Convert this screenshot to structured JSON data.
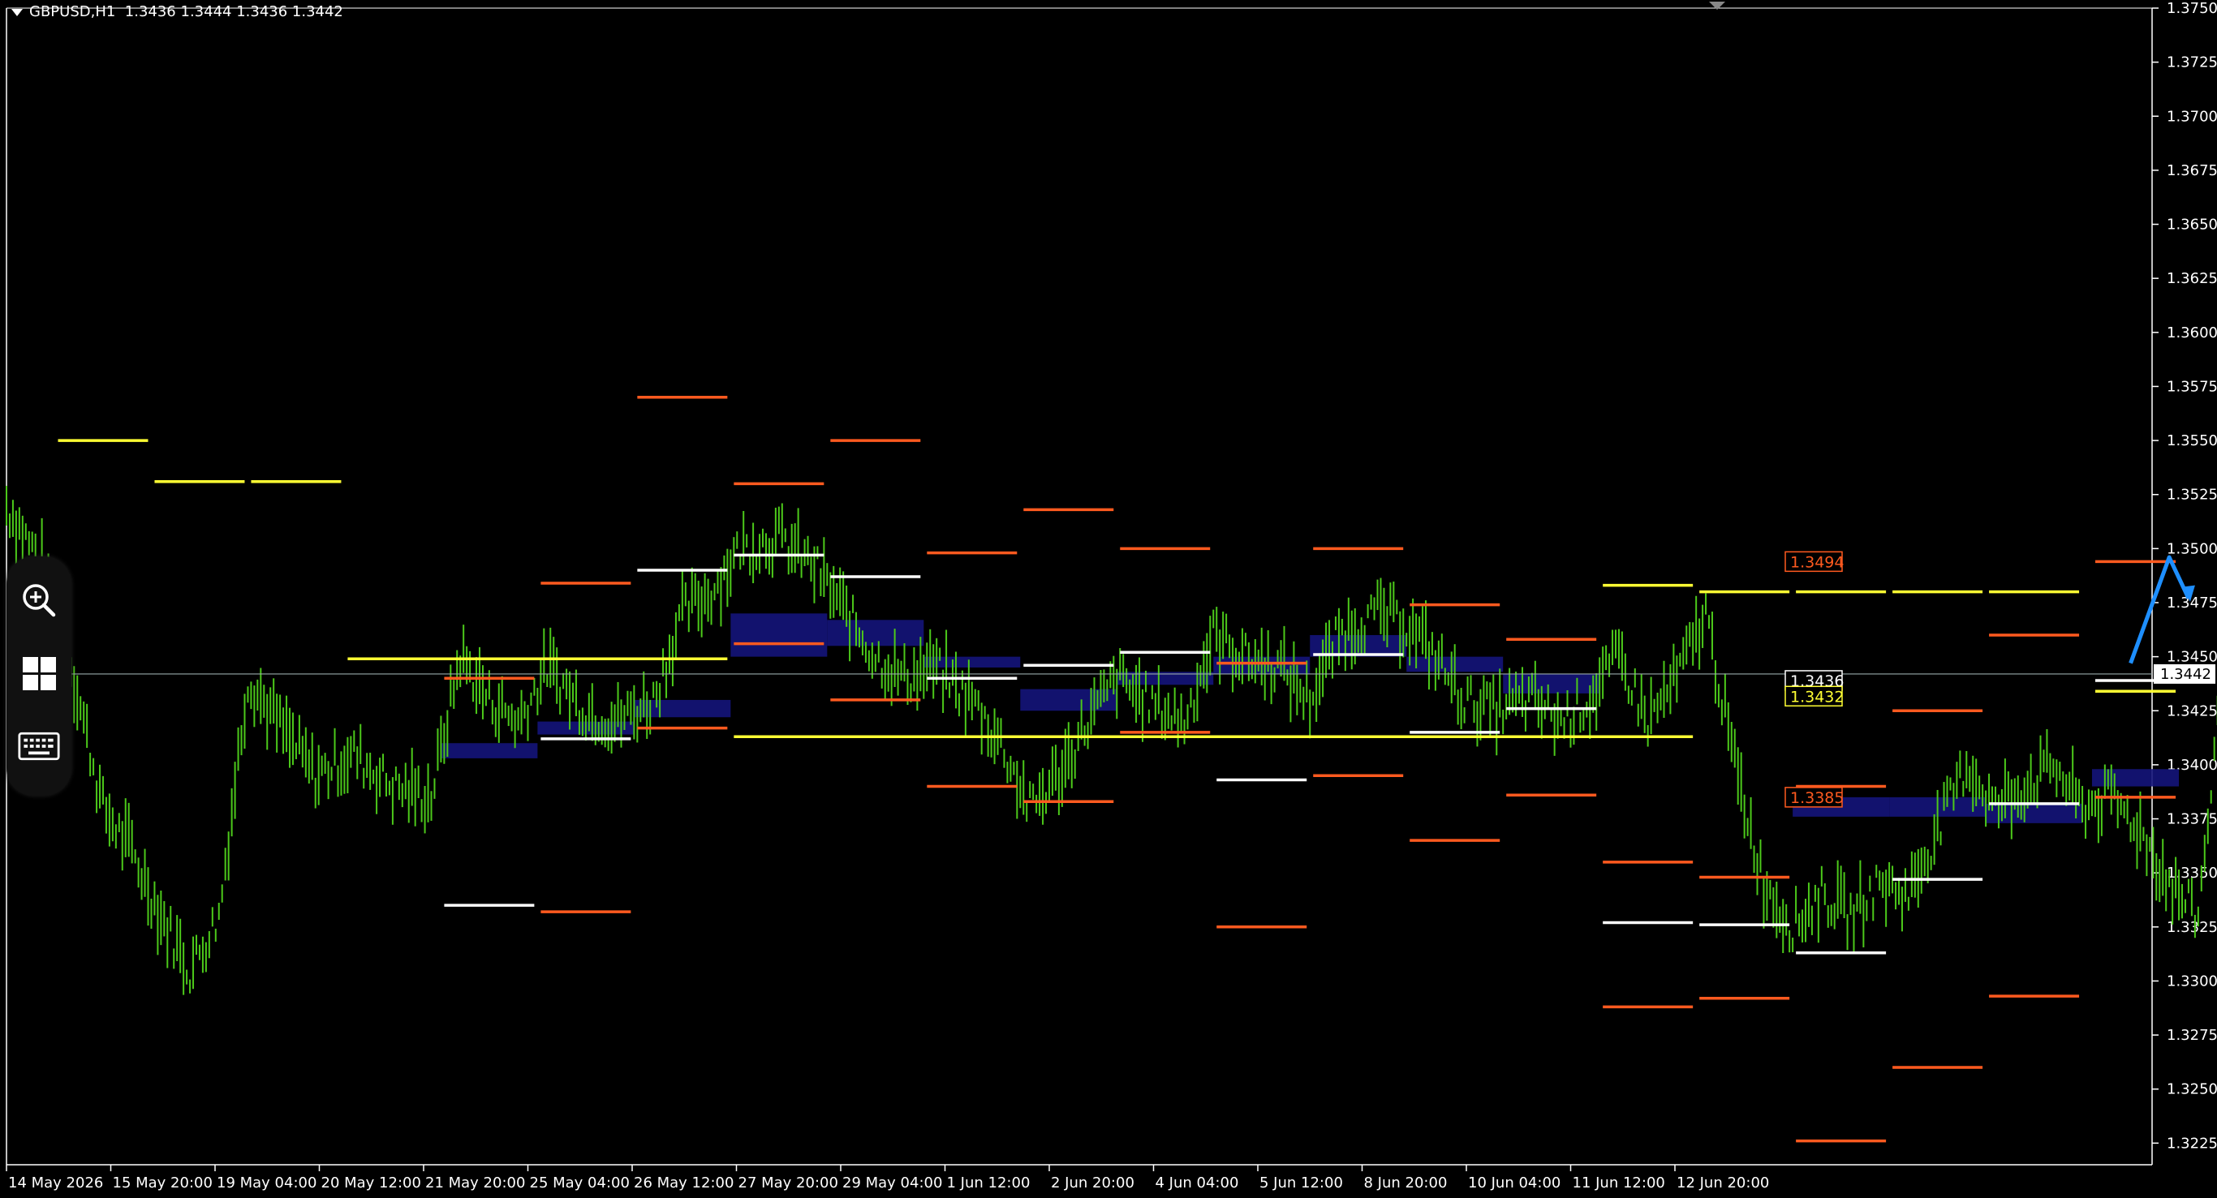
{
  "header": {
    "symbol": "GBPUSD,H1",
    "ohlc": "1.3436 1.3444 1.3436 1.3442"
  },
  "toolbar": {
    "items": [
      {
        "icon": "zoom-in-icon"
      },
      {
        "icon": "window-grid-icon"
      },
      {
        "icon": "keyboard-icon"
      }
    ]
  },
  "colors": {
    "background": "#000000",
    "candles": "#4CC91A",
    "grid_axis": "#ffffff",
    "level_orange": "#ff5a1f",
    "level_yellow": "#ffff33",
    "level_white": "#ffffff",
    "zone_blue": "#14147a",
    "arrow_blue": "#1e8fff"
  },
  "chart_data": {
    "type": "line",
    "symbol": "GBPUSD",
    "timeframe": "H1",
    "ylim": [
      1.3215,
      1.375
    ],
    "y_ticks": [
      "1.3750",
      "1.3725",
      "1.3700",
      "1.3675",
      "1.3650",
      "1.3625",
      "1.3600",
      "1.3575",
      "1.3550",
      "1.3525",
      "1.3500",
      "1.3475",
      "1.3450",
      "1.3425",
      "1.3400",
      "1.3375",
      "1.3350",
      "1.3325",
      "1.3300",
      "1.3275",
      "1.3250",
      "1.3225"
    ],
    "x_ticks": [
      "14 May 2026",
      "15 May 20:00",
      "19 May 04:00",
      "20 May 12:00",
      "21 May 20:00",
      "25 May 04:00",
      "26 May 12:00",
      "27 May 20:00",
      "29 May 04:00",
      "1 Jun 12:00",
      "2 Jun 20:00",
      "4 Jun 04:00",
      "5 Jun 12:00",
      "8 Jun 20:00",
      "10 Jun 04:00",
      "11 Jun 12:00",
      "12 Jun 20:00"
    ],
    "current_price": "1.3442",
    "price_labels": [
      {
        "text": "1.3494",
        "value": 1.3494,
        "color": "#ff5a1f"
      },
      {
        "text": "1.3436",
        "value": 1.3439,
        "color": "#ffffff"
      },
      {
        "text": "1.3432",
        "value": 1.3434,
        "color": "#ffff33"
      },
      {
        "text": "1.3385",
        "value": 1.3385,
        "color": "#ff5a1f"
      }
    ],
    "x_period_count": 22,
    "price_path": [
      [
        0,
        1.352
      ],
      [
        0.4,
        1.349
      ],
      [
        0.7,
        1.344
      ],
      [
        1.0,
        1.338
      ],
      [
        1.3,
        1.336
      ],
      [
        1.6,
        1.333
      ],
      [
        1.9,
        1.3305
      ],
      [
        2.2,
        1.333
      ],
      [
        2.5,
        1.344
      ],
      [
        2.8,
        1.342
      ],
      [
        3.2,
        1.3395
      ],
      [
        3.6,
        1.3405
      ],
      [
        4.0,
        1.339
      ],
      [
        4.4,
        1.3385
      ],
      [
        4.7,
        1.345
      ],
      [
        5.0,
        1.343
      ],
      [
        5.3,
        1.342
      ],
      [
        5.6,
        1.3445
      ],
      [
        6.0,
        1.3425
      ],
      [
        6.3,
        1.342
      ],
      [
        6.7,
        1.343
      ],
      [
        7.0,
        1.347
      ],
      [
        7.3,
        1.348
      ],
      [
        7.6,
        1.35
      ],
      [
        8.0,
        1.3505
      ],
      [
        8.4,
        1.349
      ],
      [
        8.7,
        1.347
      ],
      [
        9.0,
        1.345
      ],
      [
        9.3,
        1.344
      ],
      [
        9.6,
        1.3445
      ],
      [
        10.0,
        1.343
      ],
      [
        10.3,
        1.341
      ],
      [
        10.6,
        1.338
      ],
      [
        10.9,
        1.3395
      ],
      [
        11.2,
        1.342
      ],
      [
        11.5,
        1.344
      ],
      [
        11.8,
        1.343
      ],
      [
        12.2,
        1.342
      ],
      [
        12.5,
        1.346
      ],
      [
        12.8,
        1.345
      ],
      [
        13.2,
        1.3445
      ],
      [
        13.5,
        1.343
      ],
      [
        13.8,
        1.346
      ],
      [
        14.2,
        1.347
      ],
      [
        14.5,
        1.3465
      ],
      [
        14.8,
        1.345
      ],
      [
        15.1,
        1.343
      ],
      [
        15.4,
        1.3425
      ],
      [
        15.8,
        1.343
      ],
      [
        16.1,
        1.342
      ],
      [
        16.4,
        1.343
      ],
      [
        16.7,
        1.345
      ],
      [
        17.0,
        1.342
      ],
      [
        17.3,
        1.344
      ],
      [
        17.6,
        1.347
      ],
      [
        17.9,
        1.34
      ],
      [
        18.2,
        1.3345
      ],
      [
        18.5,
        1.3325
      ],
      [
        18.8,
        1.334
      ],
      [
        19.1,
        1.333
      ],
      [
        19.4,
        1.3345
      ],
      [
        19.7,
        1.334
      ],
      [
        20.0,
        1.337
      ],
      [
        20.3,
        1.34
      ],
      [
        20.6,
        1.338
      ],
      [
        20.9,
        1.339
      ],
      [
        21.2,
        1.34
      ],
      [
        21.5,
        1.338
      ],
      [
        21.8,
        1.3385
      ],
      [
        22.1,
        1.337
      ],
      [
        22.4,
        1.3345
      ],
      [
        22.7,
        1.333
      ],
      [
        22.9,
        1.342
      ],
      [
        23.2,
        1.341
      ],
      [
        23.5,
        1.3415
      ],
      [
        23.8,
        1.34
      ],
      [
        24.1,
        1.342
      ],
      [
        24.4,
        1.344
      ]
    ],
    "level_lines": [
      {
        "x0": 0.5,
        "x1": 1.5,
        "y": 1.355,
        "color": "#ffff33"
      },
      {
        "x0": 1.5,
        "x1": 2.5,
        "y": 1.3531,
        "color": "#ffff33"
      },
      {
        "x0": 2.5,
        "x1": 3.5,
        "y": 1.3531,
        "color": "#ffff33"
      },
      {
        "x0": 3.5,
        "x1": 7.5,
        "y": 1.3449,
        "color": "#ffff33"
      },
      {
        "x0": 4.5,
        "x1": 5.5,
        "y": 1.3335,
        "color": "#ffffff"
      },
      {
        "x0": 4.5,
        "x1": 5.5,
        "y": 1.344,
        "color": "#ff5a1f"
      },
      {
        "x0": 5.5,
        "x1": 6.5,
        "y": 1.3484,
        "color": "#ff5a1f"
      },
      {
        "x0": 5.5,
        "x1": 6.5,
        "y": 1.3332,
        "color": "#ff5a1f"
      },
      {
        "x0": 5.5,
        "x1": 6.5,
        "y": 1.3412,
        "color": "#ffffff"
      },
      {
        "x0": 6.5,
        "x1": 7.5,
        "y": 1.357,
        "color": "#ff5a1f"
      },
      {
        "x0": 6.5,
        "x1": 7.5,
        "y": 1.3417,
        "color": "#ff5a1f"
      },
      {
        "x0": 6.5,
        "x1": 7.5,
        "y": 1.349,
        "color": "#ffffff"
      },
      {
        "x0": 7.5,
        "x1": 8.5,
        "y": 1.353,
        "color": "#ff5a1f"
      },
      {
        "x0": 7.5,
        "x1": 8.5,
        "y": 1.3456,
        "color": "#ff5a1f"
      },
      {
        "x0": 7.5,
        "x1": 8.5,
        "y": 1.3497,
        "color": "#ffffff"
      },
      {
        "x0": 7.5,
        "x1": 17.5,
        "y": 1.3413,
        "color": "#ffff33"
      },
      {
        "x0": 8.5,
        "x1": 9.5,
        "y": 1.355,
        "color": "#ff5a1f"
      },
      {
        "x0": 8.5,
        "x1": 9.5,
        "y": 1.343,
        "color": "#ff5a1f"
      },
      {
        "x0": 8.5,
        "x1": 9.5,
        "y": 1.3487,
        "color": "#ffffff"
      },
      {
        "x0": 9.5,
        "x1": 10.5,
        "y": 1.3498,
        "color": "#ff5a1f"
      },
      {
        "x0": 9.5,
        "x1": 10.5,
        "y": 1.339,
        "color": "#ff5a1f"
      },
      {
        "x0": 9.5,
        "x1": 10.5,
        "y": 1.344,
        "color": "#ffffff"
      },
      {
        "x0": 10.5,
        "x1": 11.5,
        "y": 1.3518,
        "color": "#ff5a1f"
      },
      {
        "x0": 10.5,
        "x1": 11.5,
        "y": 1.3383,
        "color": "#ff5a1f"
      },
      {
        "x0": 10.5,
        "x1": 11.5,
        "y": 1.3446,
        "color": "#ffffff"
      },
      {
        "x0": 11.5,
        "x1": 12.5,
        "y": 1.35,
        "color": "#ff5a1f"
      },
      {
        "x0": 11.5,
        "x1": 12.5,
        "y": 1.3415,
        "color": "#ff5a1f"
      },
      {
        "x0": 11.5,
        "x1": 12.5,
        "y": 1.3452,
        "color": "#ffffff"
      },
      {
        "x0": 12.5,
        "x1": 13.5,
        "y": 1.3447,
        "color": "#ff5a1f"
      },
      {
        "x0": 12.5,
        "x1": 13.5,
        "y": 1.3325,
        "color": "#ff5a1f"
      },
      {
        "x0": 12.5,
        "x1": 13.5,
        "y": 1.3393,
        "color": "#ffffff"
      },
      {
        "x0": 13.5,
        "x1": 14.5,
        "y": 1.35,
        "color": "#ff5a1f"
      },
      {
        "x0": 13.5,
        "x1": 14.5,
        "y": 1.3395,
        "color": "#ff5a1f"
      },
      {
        "x0": 13.5,
        "x1": 14.5,
        "y": 1.3451,
        "color": "#ffffff"
      },
      {
        "x0": 14.5,
        "x1": 15.5,
        "y": 1.3474,
        "color": "#ff5a1f"
      },
      {
        "x0": 14.5,
        "x1": 15.5,
        "y": 1.3365,
        "color": "#ff5a1f"
      },
      {
        "x0": 14.5,
        "x1": 15.5,
        "y": 1.3415,
        "color": "#ffffff"
      },
      {
        "x0": 15.5,
        "x1": 16.5,
        "y": 1.3458,
        "color": "#ff5a1f"
      },
      {
        "x0": 15.5,
        "x1": 16.5,
        "y": 1.3386,
        "color": "#ff5a1f"
      },
      {
        "x0": 15.5,
        "x1": 16.5,
        "y": 1.3426,
        "color": "#ffffff"
      },
      {
        "x0": 16.5,
        "x1": 17.5,
        "y": 1.3483,
        "color": "#ffff33"
      },
      {
        "x0": 16.5,
        "x1": 17.5,
        "y": 1.3355,
        "color": "#ff5a1f"
      },
      {
        "x0": 16.5,
        "x1": 17.5,
        "y": 1.3288,
        "color": "#ff5a1f"
      },
      {
        "x0": 16.5,
        "x1": 17.5,
        "y": 1.3327,
        "color": "#ffffff"
      },
      {
        "x0": 17.5,
        "x1": 18.5,
        "y": 1.348,
        "color": "#ffff33"
      },
      {
        "x0": 17.5,
        "x1": 18.5,
        "y": 1.3348,
        "color": "#ff5a1f"
      },
      {
        "x0": 17.5,
        "x1": 18.5,
        "y": 1.3292,
        "color": "#ff5a1f"
      },
      {
        "x0": 17.5,
        "x1": 18.5,
        "y": 1.3326,
        "color": "#ffffff"
      },
      {
        "x0": 18.5,
        "x1": 19.5,
        "y": 1.348,
        "color": "#ffff33"
      },
      {
        "x0": 18.5,
        "x1": 19.5,
        "y": 1.339,
        "color": "#ff5a1f"
      },
      {
        "x0": 18.5,
        "x1": 19.5,
        "y": 1.3226,
        "color": "#ff5a1f"
      },
      {
        "x0": 18.5,
        "x1": 19.5,
        "y": 1.3313,
        "color": "#ffffff"
      },
      {
        "x0": 19.5,
        "x1": 20.5,
        "y": 1.348,
        "color": "#ffff33"
      },
      {
        "x0": 19.5,
        "x1": 20.5,
        "y": 1.3425,
        "color": "#ff5a1f"
      },
      {
        "x0": 19.5,
        "x1": 20.5,
        "y": 1.326,
        "color": "#ff5a1f"
      },
      {
        "x0": 19.5,
        "x1": 20.5,
        "y": 1.3347,
        "color": "#ffffff"
      },
      {
        "x0": 20.5,
        "x1": 21.5,
        "y": 1.348,
        "color": "#ffff33"
      },
      {
        "x0": 20.5,
        "x1": 21.5,
        "y": 1.346,
        "color": "#ff5a1f"
      },
      {
        "x0": 20.5,
        "x1": 21.5,
        "y": 1.3293,
        "color": "#ff5a1f"
      },
      {
        "x0": 20.5,
        "x1": 21.5,
        "y": 1.3382,
        "color": "#ffffff"
      },
      {
        "x0": 21.6,
        "x1": 22.5,
        "y": 1.3494,
        "color": "#ff5a1f"
      },
      {
        "x0": 21.6,
        "x1": 22.5,
        "y": 1.3385,
        "color": "#ff5a1f"
      },
      {
        "x0": 21.6,
        "x1": 22.5,
        "y": 1.3439,
        "color": "#ffffff"
      },
      {
        "x0": 21.6,
        "x1": 22.5,
        "y": 1.3434,
        "color": "#ffff33"
      }
    ],
    "zones": [
      {
        "x0": 4.5,
        "x1": 5.5,
        "y0": 1.3403,
        "y1": 1.341
      },
      {
        "x0": 5.5,
        "x1": 6.5,
        "y0": 1.3414,
        "y1": 1.342
      },
      {
        "x0": 6.5,
        "x1": 7.5,
        "y0": 1.3422,
        "y1": 1.343
      },
      {
        "x0": 7.5,
        "x1": 8.5,
        "y0": 1.345,
        "y1": 1.347
      },
      {
        "x0": 8.5,
        "x1": 9.5,
        "y0": 1.3455,
        "y1": 1.3467
      },
      {
        "x0": 9.5,
        "x1": 10.5,
        "y0": 1.3445,
        "y1": 1.345
      },
      {
        "x0": 10.5,
        "x1": 11.5,
        "y0": 1.3425,
        "y1": 1.3435
      },
      {
        "x0": 11.5,
        "x1": 12.5,
        "y0": 1.3437,
        "y1": 1.3443
      },
      {
        "x0": 12.5,
        "x1": 13.5,
        "y0": 1.3442,
        "y1": 1.345
      },
      {
        "x0": 13.5,
        "x1": 14.5,
        "y0": 1.345,
        "y1": 1.346
      },
      {
        "x0": 14.5,
        "x1": 15.5,
        "y0": 1.3443,
        "y1": 1.345
      },
      {
        "x0": 15.5,
        "x1": 16.5,
        "y0": 1.3433,
        "y1": 1.3442
      },
      {
        "x0": 18.5,
        "x1": 19.5,
        "y0": 1.3376,
        "y1": 1.3385
      },
      {
        "x0": 19.5,
        "x1": 20.5,
        "y0": 1.3376,
        "y1": 1.3385
      },
      {
        "x0": 20.5,
        "x1": 21.5,
        "y0": 1.3373,
        "y1": 1.3382
      },
      {
        "x0": 21.6,
        "x1": 22.5,
        "y0": 1.339,
        "y1": 1.3398
      }
    ],
    "forecast_arrow": {
      "x": [
        22.0,
        22.4,
        22.6
      ],
      "y": [
        1.3447,
        1.3496,
        1.3477
      ]
    }
  }
}
